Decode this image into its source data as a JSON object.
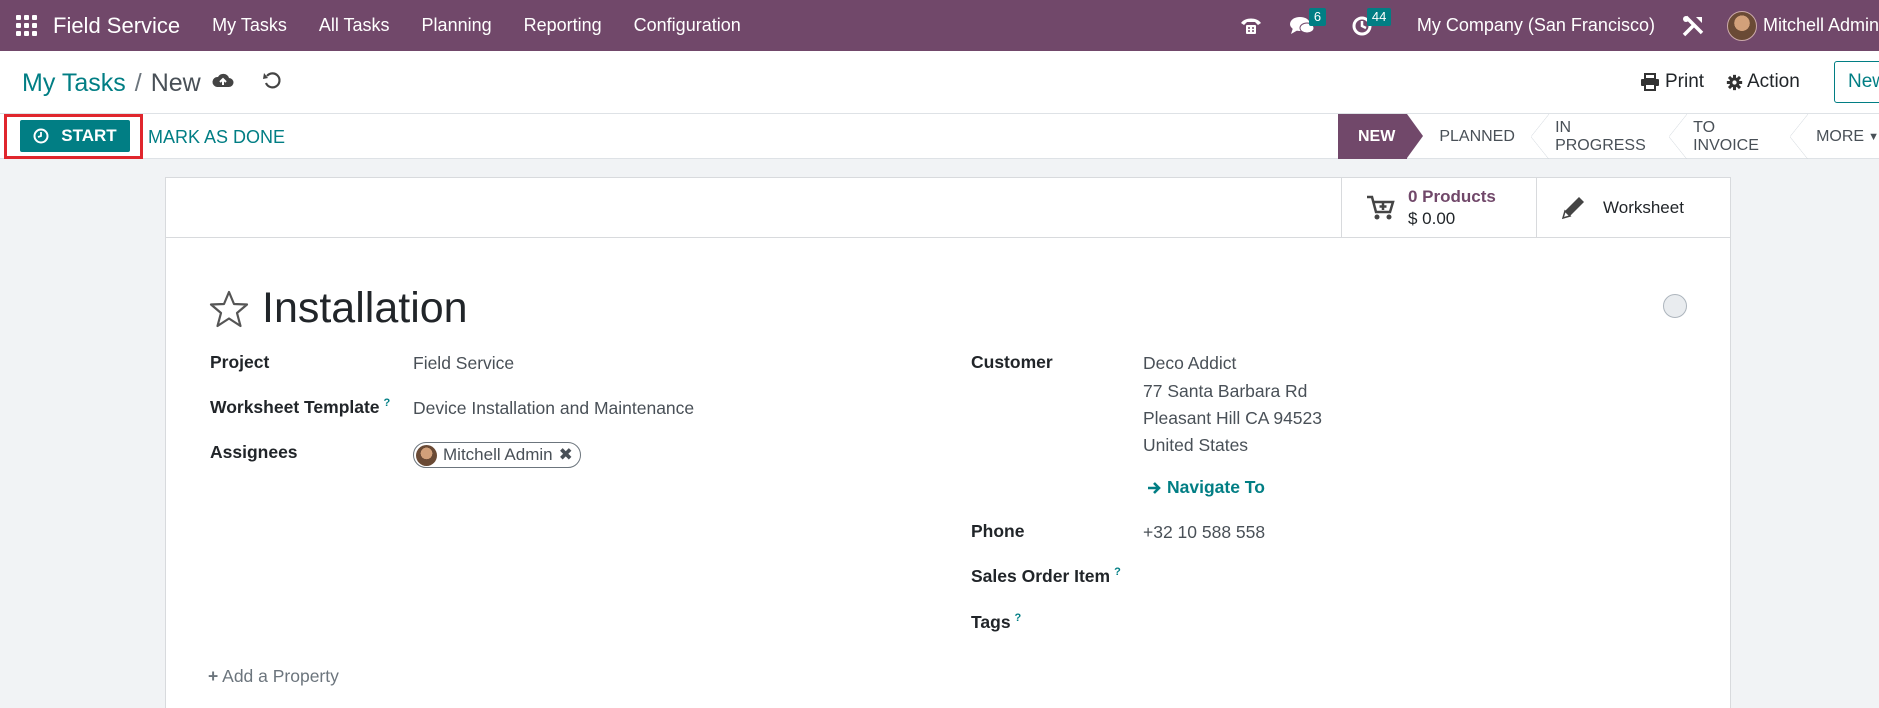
{
  "navbar": {
    "brand": "Field Service",
    "menu": [
      "My Tasks",
      "All Tasks",
      "Planning",
      "Reporting",
      "Configuration"
    ],
    "messages_count": "6",
    "activities_count": "44",
    "company": "My Company (San Francisco)",
    "user": "Mitchell Admin"
  },
  "breadcrumb": {
    "parent": "My Tasks",
    "separator": "/",
    "current": "New"
  },
  "control": {
    "print_label": "Print",
    "action_label": "Action",
    "new_label": "New"
  },
  "statusbar": {
    "start_label": "START",
    "mark_done_label": "MARK AS DONE",
    "stages": [
      "NEW",
      "PLANNED",
      "IN PROGRESS",
      "TO INVOICE"
    ],
    "active_stage": "NEW",
    "more_label": "MORE"
  },
  "button_box": {
    "products_count": "0 Products",
    "products_amount": "$ 0.00",
    "worksheet_label": "Worksheet"
  },
  "form": {
    "title": "Installation",
    "project_label": "Project",
    "project_value": "Field Service",
    "worksheet_template_label": "Worksheet Template",
    "worksheet_template_value": "Device Installation and Maintenance",
    "assignees_label": "Assignees",
    "assignee": "Mitchell Admin",
    "customer_label": "Customer",
    "customer_name": "Deco Addict",
    "customer_street": "77 Santa Barbara Rd",
    "customer_city": "Pleasant Hill CA 94523",
    "customer_country": "United States",
    "navigate_label": "Navigate To",
    "phone_label": "Phone",
    "phone_value": "+32 10 588 558",
    "sales_order_item_label": "Sales Order Item",
    "tags_label": "Tags",
    "help_mark": "?",
    "add_property_label": "Add a Property"
  },
  "colors": {
    "brand": "#71486a",
    "accent": "#017e84",
    "highlight": "#e0262d"
  }
}
